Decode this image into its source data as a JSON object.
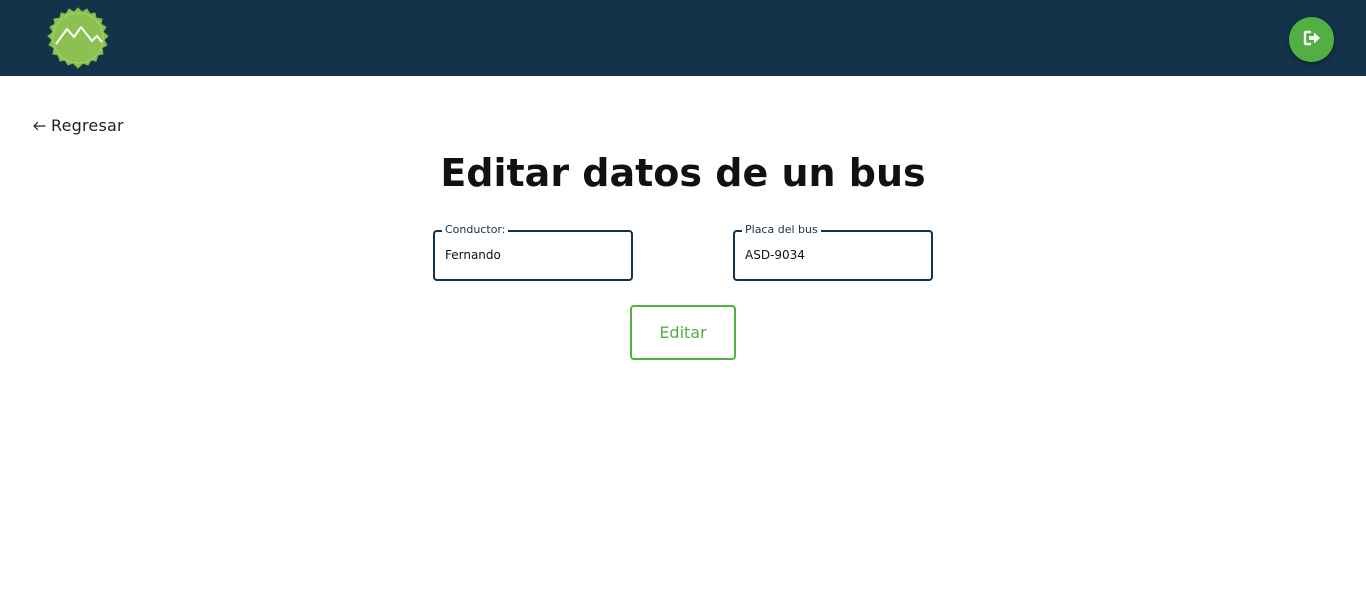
{
  "header": {
    "logo_icon": "mountain-badge-icon",
    "logout_icon": "sign-out-icon",
    "colors": {
      "bar": "#13334a",
      "accent": "#52b043"
    }
  },
  "nav": {
    "back_label": "Regresar",
    "back_icon": "arrow-left-icon"
  },
  "main": {
    "title": "Editar datos de un bus",
    "fields": {
      "conductor": {
        "label": "Conductor:",
        "value": "Fernando"
      },
      "placa": {
        "label": "Placa del bus",
        "value": "ASD-9034"
      }
    },
    "submit_label": "Editar"
  }
}
